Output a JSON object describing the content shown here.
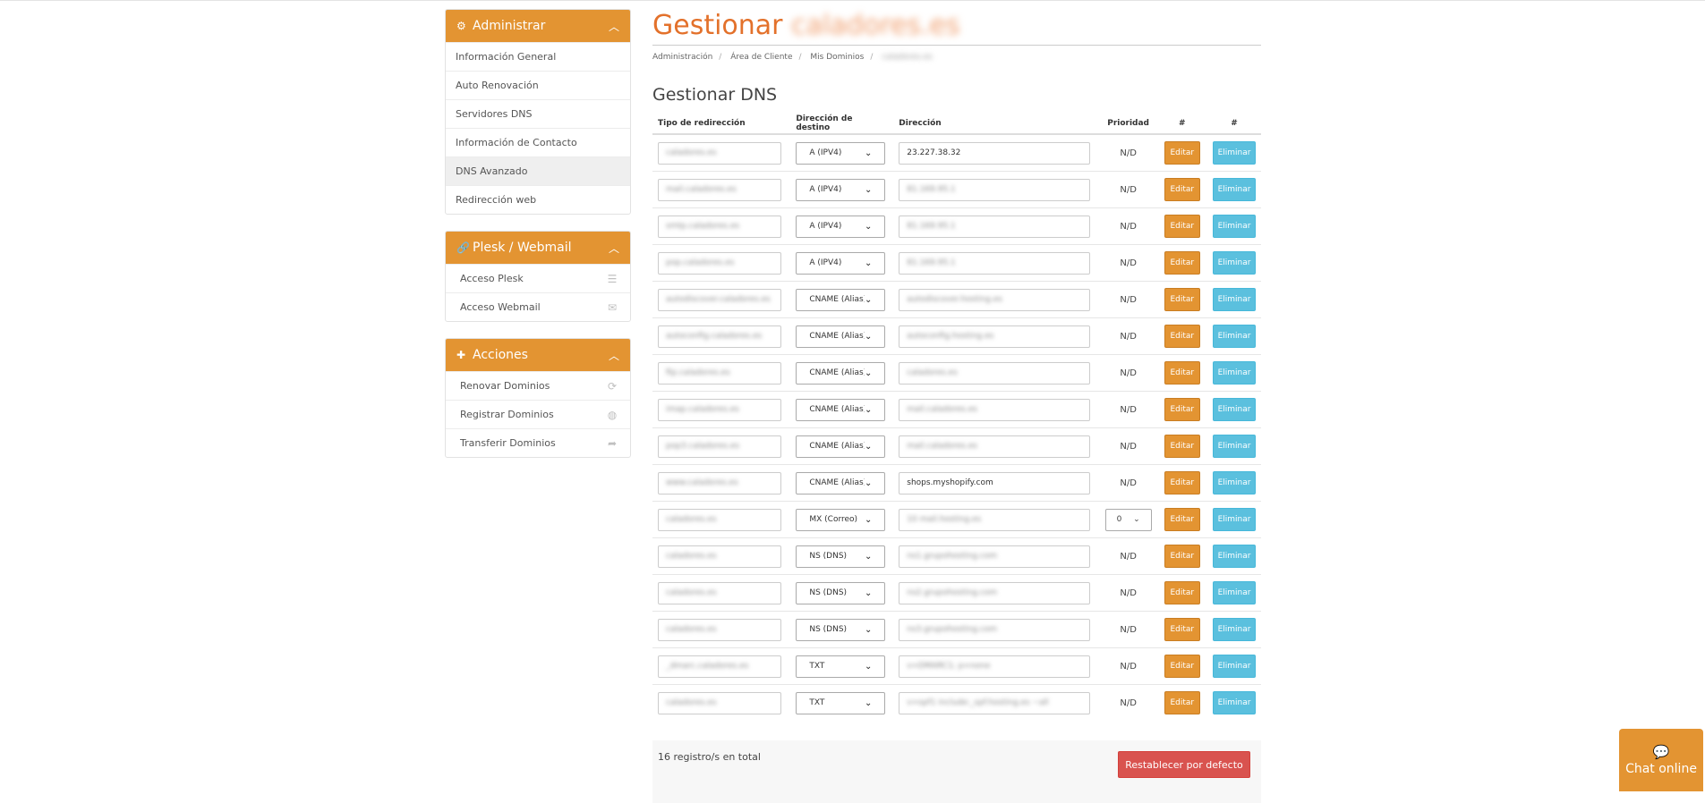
{
  "sidebar": {
    "panels": [
      {
        "title": "Administrar",
        "icon": "gear-icon",
        "items": [
          {
            "label": "Información General"
          },
          {
            "label": "Auto Renovación"
          },
          {
            "label": "Servidores DNS"
          },
          {
            "label": "Información de Contacto"
          },
          {
            "label": "DNS Avanzado",
            "active": true
          },
          {
            "label": "Redirección web"
          }
        ]
      },
      {
        "title": "Plesk / Webmail",
        "icon": "link-icon",
        "items": [
          {
            "label": "Acceso Plesk",
            "icon": "server-icon"
          },
          {
            "label": "Acceso Webmail",
            "icon": "envelope-icon"
          }
        ]
      },
      {
        "title": "Acciones",
        "icon": "plus-icon",
        "items": [
          {
            "label": "Renovar Dominios",
            "icon": "refresh-icon"
          },
          {
            "label": "Registrar Dominios",
            "icon": "globe-icon"
          },
          {
            "label": "Transferir Dominios",
            "icon": "share-icon"
          }
        ]
      }
    ]
  },
  "header": {
    "title": "Gestionar",
    "title_suffix": "caladores.es",
    "breadcrumb": [
      "Administración",
      "Área de Cliente",
      "Mis Dominios",
      "caladores.es"
    ]
  },
  "section_title": "Gestionar DNS",
  "table": {
    "headers": [
      "Tipo de redirección",
      "Dirección de destino",
      "Dirección",
      "Prioridad",
      "#",
      "#"
    ],
    "rows": [
      {
        "name": "caladores.es",
        "type": "A (IPV4)",
        "address": "23.227.38.32",
        "address_blurred": false,
        "priority": "N/D"
      },
      {
        "name": "mail.caladores.es",
        "type": "A (IPV4)",
        "address": "81.169.95.1",
        "address_blurred": true,
        "priority": "N/D"
      },
      {
        "name": "smtp.caladores.es",
        "type": "A (IPV4)",
        "address": "81.169.95.1",
        "address_blurred": true,
        "priority": "N/D"
      },
      {
        "name": "pop.caladores.es",
        "type": "A (IPV4)",
        "address": "81.169.95.1",
        "address_blurred": true,
        "priority": "N/D"
      },
      {
        "name": "autodiscover.caladores.es",
        "type": "CNAME (Alias)",
        "address": "autodiscover.hosting.es",
        "address_blurred": true,
        "priority": "N/D"
      },
      {
        "name": "autoconfig.caladores.es",
        "type": "CNAME (Alias)",
        "address": "autoconfig.hosting.es",
        "address_blurred": true,
        "priority": "N/D"
      },
      {
        "name": "ftp.caladores.es",
        "type": "CNAME (Alias)",
        "address": "caladores.es",
        "address_blurred": true,
        "priority": "N/D"
      },
      {
        "name": "imap.caladores.es",
        "type": "CNAME (Alias)",
        "address": "mail.caladores.es",
        "address_blurred": true,
        "priority": "N/D"
      },
      {
        "name": "pop3.caladores.es",
        "type": "CNAME (Alias)",
        "address": "mail.caladores.es",
        "address_blurred": true,
        "priority": "N/D"
      },
      {
        "name": "www.caladores.es",
        "type": "CNAME (Alias)",
        "address": "shops.myshopify.com",
        "address_blurred": false,
        "priority": "N/D"
      },
      {
        "name": "caladores.es",
        "type": "MX (Correo)",
        "address": "10 mail.hosting.es",
        "address_blurred": true,
        "priority": "0",
        "priority_select": true
      },
      {
        "name": "caladores.es",
        "type": "NS (DNS)",
        "address": "ns1.grupohosting.com",
        "address_blurred": true,
        "priority": "N/D"
      },
      {
        "name": "caladores.es",
        "type": "NS (DNS)",
        "address": "ns2.grupohosting.com",
        "address_blurred": true,
        "priority": "N/D"
      },
      {
        "name": "caladores.es",
        "type": "NS (DNS)",
        "address": "ns3.grupohosting.com",
        "address_blurred": true,
        "priority": "N/D"
      },
      {
        "name": "_dmarc.caladores.es",
        "type": "TXT",
        "address": "v=DMARC1; p=none",
        "address_blurred": true,
        "priority": "N/D"
      },
      {
        "name": "caladores.es",
        "type": "TXT",
        "address": "v=spf1 include:_spf.hosting.es ~all",
        "address_blurred": true,
        "priority": "N/D"
      }
    ],
    "edit_label": "Editar",
    "delete_label": "Eliminar"
  },
  "footer": {
    "count": "16 registro/s en total",
    "reset_label": "Restablecer por defecto"
  },
  "chat": {
    "label": "Chat online"
  },
  "colors": {
    "accent": "#e39432",
    "title": "#e3712b",
    "info": "#5bc0de",
    "danger": "#d9534f"
  }
}
